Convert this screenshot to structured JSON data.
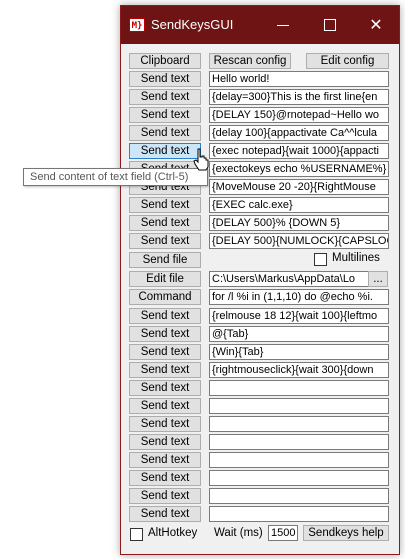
{
  "window": {
    "title": "SendKeysGUI",
    "icon_text": "M}"
  },
  "toolbar": {
    "clipboard": "Clipboard",
    "rescan": "Rescan config",
    "edit_config": "Edit config"
  },
  "rows_a": [
    {
      "button": "Send text",
      "text": "Hello world!"
    },
    {
      "button": "Send text",
      "text": "{delay=300}This is the first line{en"
    },
    {
      "button": "Send text",
      "text": "{DELAY 150}@rnotepad~Hello wo"
    },
    {
      "button": "Send text",
      "text": "{delay 100}{appactivate Ca^^lcula"
    },
    {
      "button": "Send text",
      "text": "{exec notepad}{wait 1000}{appacti"
    },
    {
      "button": "Send text",
      "text": "{exectokeys echo %USERNAME%}"
    },
    {
      "button": "Send text",
      "text": "{MoveMouse 20 -20}{RightMouse"
    },
    {
      "button": "Send text",
      "text": "{EXEC calc.exe}"
    },
    {
      "button": "Send text",
      "text": "{DELAY 500}% {DOWN 5}"
    },
    {
      "button": "Send text",
      "text": "{DELAY 500}{NUMLOCK}{CAPSLOC"
    }
  ],
  "send_file": {
    "button": "Send file",
    "multilines_label": "Multilines"
  },
  "edit_file": {
    "button": "Edit file",
    "path": "C:\\Users\\Markus\\AppData\\Lo",
    "browse": "..."
  },
  "command": {
    "button": "Command",
    "text": "for /l %i in (1,1,10) do @echo %i."
  },
  "rows_b": [
    {
      "button": "Send text",
      "text": "{relmouse 18 12}{wait 100}{leftmo"
    },
    {
      "button": "Send text",
      "text": "@{Tab}"
    },
    {
      "button": "Send text",
      "text": "{Win}{Tab}"
    },
    {
      "button": "Send text",
      "text": "{rightmouseclick}{wait 300}{down"
    },
    {
      "button": "Send text",
      "text": ""
    },
    {
      "button": "Send text",
      "text": ""
    },
    {
      "button": "Send text",
      "text": ""
    },
    {
      "button": "Send text",
      "text": ""
    },
    {
      "button": "Send text",
      "text": ""
    },
    {
      "button": "Send text",
      "text": ""
    },
    {
      "button": "Send text",
      "text": ""
    },
    {
      "button": "Send text",
      "text": ""
    }
  ],
  "footer": {
    "althotkey_label": "AltHotkey",
    "wait_label": "Wait (ms)",
    "wait_value": "1500",
    "help": "Sendkeys help"
  },
  "tooltip": "Send content of text field (Ctrl-5)",
  "colors": {
    "titlebar": "#6e1414",
    "button_hover": "#cde6f7"
  }
}
